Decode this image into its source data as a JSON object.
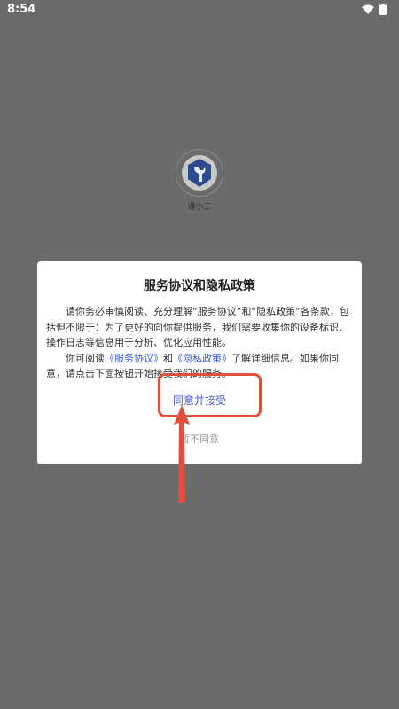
{
  "status_bar": {
    "time": "8:54",
    "icons": [
      "wifi-icon",
      "battery-icon"
    ]
  },
  "app": {
    "name": "课小三",
    "logo_icon": "wrench-logo-icon"
  },
  "dialog": {
    "title": "服务协议和隐私政策",
    "paragraph1": "请你务必审慎阅读、充分理解“服务协议”和“隐私政策”各条款，包括但不限于：为了更好的向你提供服务，我们需要收集你的设备标识、操作日志等信息用于分析、优化应用性能。",
    "paragraph2_prefix": "你可阅读",
    "service_link": "《服务协议》",
    "and_text": "和",
    "privacy_link": "《隐私政策》",
    "paragraph2_suffix": "了解详细信息。如果你同意，请点击下面按钮开始接受我们的服务。",
    "accept_label": "同意并接受",
    "decline_label": "暂不同意"
  },
  "annotation": {
    "color": "#e0503f"
  }
}
